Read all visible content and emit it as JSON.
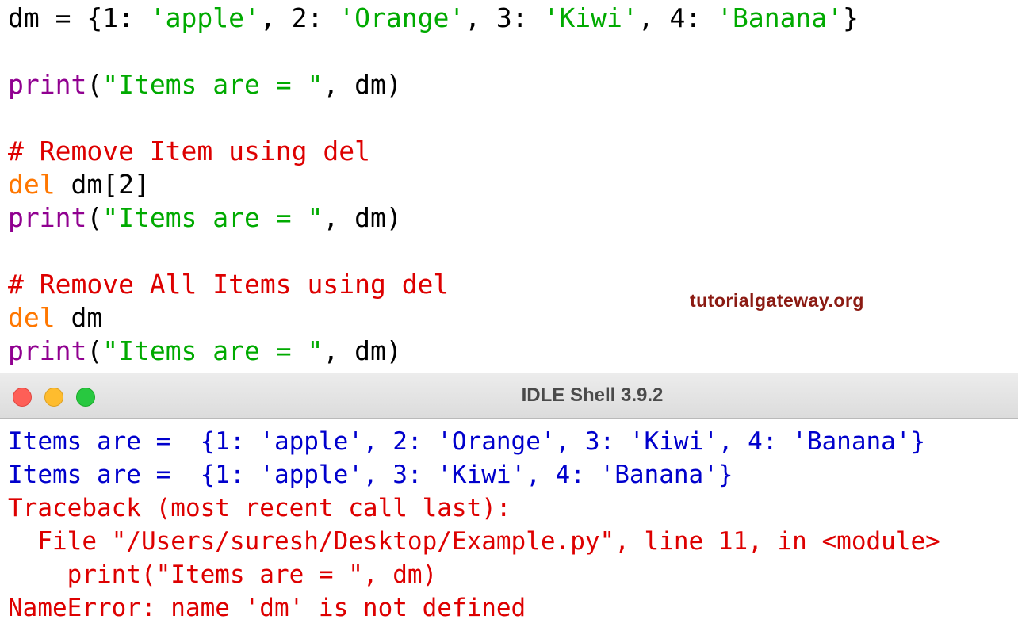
{
  "editor": {
    "lines": [
      {
        "tokens": [
          {
            "text": "dm = {1: ",
            "cls": "c-def"
          },
          {
            "text": "'apple'",
            "cls": "c-str"
          },
          {
            "text": ", 2: ",
            "cls": "c-def"
          },
          {
            "text": "'Orange'",
            "cls": "c-str"
          },
          {
            "text": ", 3: ",
            "cls": "c-def"
          },
          {
            "text": "'Kiwi'",
            "cls": "c-str"
          },
          {
            "text": ", 4: ",
            "cls": "c-def"
          },
          {
            "text": "'Banana'",
            "cls": "c-str"
          },
          {
            "text": "}",
            "cls": "c-def"
          }
        ]
      },
      {
        "tokens": [
          {
            "text": "print",
            "cls": "c-bi"
          },
          {
            "text": "(",
            "cls": "c-def"
          },
          {
            "text": "\"Items are = \"",
            "cls": "c-str"
          },
          {
            "text": ", dm)",
            "cls": "c-def"
          }
        ]
      },
      {
        "tokens": [
          {
            "text": "# Remove Item using del",
            "cls": "c-cm"
          }
        ]
      },
      {
        "tokens": [
          {
            "text": "del",
            "cls": "c-kw"
          },
          {
            "text": " dm[2]",
            "cls": "c-def"
          }
        ]
      },
      {
        "tokens": [
          {
            "text": "print",
            "cls": "c-bi"
          },
          {
            "text": "(",
            "cls": "c-def"
          },
          {
            "text": "\"Items are = \"",
            "cls": "c-str"
          },
          {
            "text": ", dm)",
            "cls": "c-def"
          }
        ]
      },
      {
        "tokens": [
          {
            "text": "# Remove All Items using del",
            "cls": "c-cm"
          }
        ]
      },
      {
        "tokens": [
          {
            "text": "del",
            "cls": "c-kw"
          },
          {
            "text": " dm",
            "cls": "c-def"
          }
        ]
      },
      {
        "tokens": [
          {
            "text": "print",
            "cls": "c-bi"
          },
          {
            "text": "(",
            "cls": "c-def"
          },
          {
            "text": "\"Items are = \"",
            "cls": "c-str"
          },
          {
            "text": ", dm)",
            "cls": "c-def"
          }
        ]
      }
    ]
  },
  "watermark": "tutorialgateway.org",
  "shell": {
    "title": "IDLE Shell 3.9.2",
    "output": [
      {
        "text": "Items are =  {1: 'apple', 2: 'Orange', 3: 'Kiwi', 4: 'Banana'}",
        "cls": "out-blue"
      },
      {
        "text": "Items are =  {1: 'apple', 3: 'Kiwi', 4: 'Banana'}",
        "cls": "out-blue"
      },
      {
        "text": "Traceback (most recent call last):",
        "cls": "out-red"
      },
      {
        "text": "  File \"/Users/suresh/Desktop/Example.py\", line 11, in <module>",
        "cls": "out-red"
      },
      {
        "text": "    print(\"Items are = \", dm)",
        "cls": "out-red"
      },
      {
        "text": "NameError: name 'dm' is not defined",
        "cls": "out-red"
      }
    ]
  },
  "colors": {
    "keyword": "#ff7700",
    "builtin": "#900090",
    "string": "#00aa00",
    "comment": "#dd0000",
    "stdout": "#0000cc",
    "stderr": "#dd0000",
    "watermark": "#8b1a12"
  }
}
